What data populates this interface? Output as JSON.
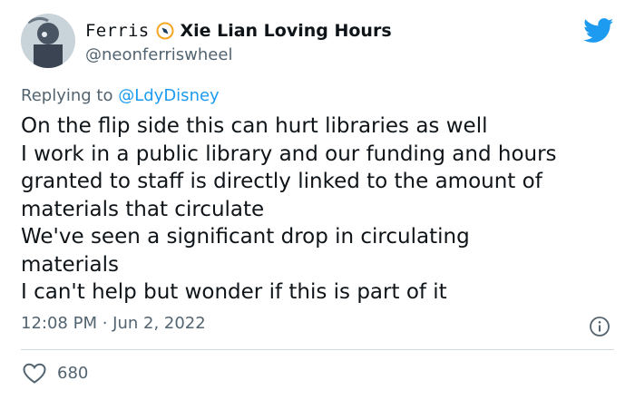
{
  "author": {
    "name_part1": "Ferris",
    "name_part2": "Xie Lian Loving Hours",
    "handle": "@neonferriswheel",
    "badge_icon": "compass-badge-icon"
  },
  "reply": {
    "prefix": "Replying to",
    "to_handle": "@LdyDisney"
  },
  "tweet": {
    "lines": [
      "On the flip side this can hurt libraries as well",
      "I work in a public library and our funding and hours",
      "granted to staff is directly linked to the amount of",
      "materials that circulate",
      "We've seen a significant drop in circulating",
      "materials",
      "I can't help but wonder if this is part of it"
    ]
  },
  "meta": {
    "timestamp": "12:08 PM · Jun 2, 2022"
  },
  "engagement": {
    "likes": "680"
  },
  "colors": {
    "brand_blue": "#1d9bf0",
    "secondary_text": "#536471",
    "badge_orange": "#f5a623"
  }
}
